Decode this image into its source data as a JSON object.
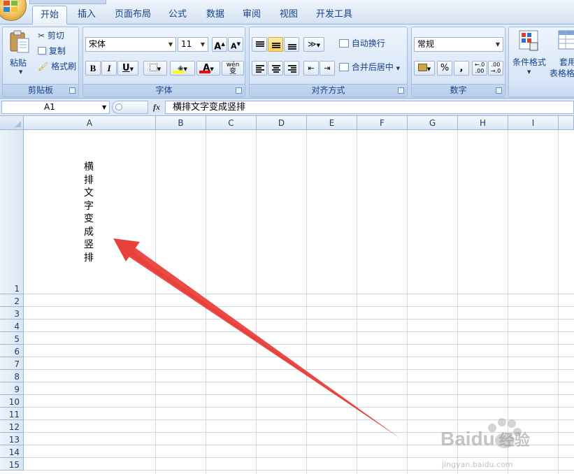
{
  "tabs": [
    "开始",
    "插入",
    "页面布局",
    "公式",
    "数据",
    "审阅",
    "视图",
    "开发工具"
  ],
  "active_tab": "开始",
  "clipboard": {
    "paste_label": "粘贴",
    "cut_label": "剪切",
    "copy_label": "复制",
    "format_painter_label": "格式刷",
    "group_label": "剪贴板"
  },
  "font": {
    "font_name": "宋体",
    "font_size": "11",
    "grow_label": "A",
    "shrink_label": "A",
    "bold_label": "B",
    "italic_label": "I",
    "underline_label": "U",
    "font_color_label": "A",
    "phonetic_label": "wén",
    "phonetic_char": "变",
    "group_label": "字体",
    "highlight_color": "#ffff00",
    "font_color": "#ff0000"
  },
  "alignment": {
    "wrap_text_label": "自动换行",
    "merge_center_label": "合并后居中",
    "group_label": "对齐方式"
  },
  "number": {
    "format_value": "常规",
    "percent_label": "%",
    "comma_label": ",",
    "inc_decimal_label": ".00",
    "dec_decimal_label": ".00",
    "group_label": "数字"
  },
  "styles": {
    "conditional_format_label": "条件格式",
    "table_format_label_line1": "套用",
    "table_format_label_line2": "表格格"
  },
  "formula_bar": {
    "name_box": "A1",
    "fx_label": "fx",
    "content": "横排文字变成竖排"
  },
  "columns": [
    "A",
    "B",
    "C",
    "D",
    "E",
    "F",
    "G",
    "H",
    "I"
  ],
  "rows": [
    "1",
    "2",
    "3",
    "4",
    "5",
    "6",
    "7",
    "8",
    "9",
    "10",
    "11",
    "12",
    "13",
    "14",
    "15"
  ],
  "cell_a1": "横排文字变成竖排",
  "annotation": {
    "arrow_color": "#e8413c"
  },
  "watermark": {
    "brand": "Baidu",
    "brand_cn": "经验",
    "url": "jingyan.baidu.com"
  }
}
